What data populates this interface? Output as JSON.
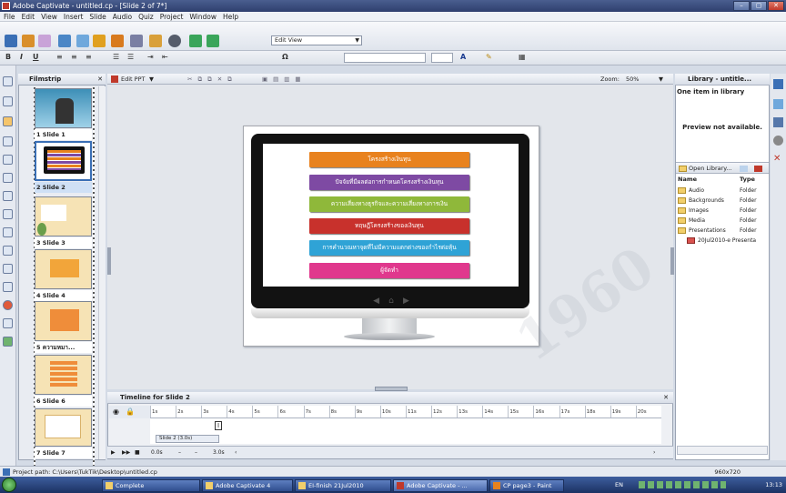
{
  "window": {
    "title": "Adobe Captivate - untitled.cp - [Slide 2 of 7*]",
    "controls": [
      "–",
      "▢",
      "✕"
    ]
  },
  "menu": [
    "File",
    "Edit",
    "View",
    "Insert",
    "Slide",
    "Audio",
    "Quiz",
    "Project",
    "Window",
    "Help"
  ],
  "toolbar": {
    "view_select": "Edit View"
  },
  "format": {
    "bold": "B",
    "italic": "I",
    "underline": "U",
    "omega": "Ω"
  },
  "filmstrip": {
    "title": "Filmstrip",
    "close": "✕",
    "slides": [
      {
        "label": "1 Slide 1"
      },
      {
        "label": "2 Slide 2"
      },
      {
        "label": "3 Slide 3"
      },
      {
        "label": "4 Slide 4"
      },
      {
        "label": "5 ความหมา..."
      },
      {
        "label": "6 Slide 6"
      },
      {
        "label": "7 Slide 7"
      }
    ]
  },
  "stage": {
    "edit_ppt": "Edit PPT",
    "zoom_label": "Zoom:",
    "zoom_value": "50%"
  },
  "slide_menu": [
    {
      "text": "โครงสร้างเงินทุน",
      "color": "#e8821e"
    },
    {
      "text": "ปัจจัยที่มีผลต่อการกำหนดโครงสร้างเงินทุน",
      "color": "#7e4aa3"
    },
    {
      "text": "ความเสี่ยงทางธุรกิจและความเสี่ยงทางการเงิน",
      "color": "#8fb83a"
    },
    {
      "text": "ทฤษฎีโครงสร้างของเงินทุน",
      "color": "#c8312c"
    },
    {
      "text": "การคำนวณหาจุดที่ไม่มีความแตกต่างของกำไรต่อหุ้น",
      "color": "#2fa3d6"
    },
    {
      "text": "ผู้จัดทำ",
      "color": "#e0388d"
    }
  ],
  "nav_icons": [
    "◀",
    "⌂",
    "▶"
  ],
  "timeline": {
    "title": "Timeline for Slide 2",
    "close": "✕",
    "ticks": [
      "1s",
      "2s",
      "3s",
      "4s",
      "5s",
      "6s",
      "7s",
      "8s",
      "9s",
      "10s",
      "11s",
      "12s",
      "13s",
      "14s",
      "15s",
      "16s",
      "17s",
      "18s",
      "19s",
      "20s"
    ],
    "track_label": "Slide 2 (3.0s)",
    "time_start": "0.0s",
    "time_end": "3.0s"
  },
  "library": {
    "title": "Library - untitle...",
    "count": "One item in library",
    "preview": "Preview not available.",
    "open": "Open Library...",
    "col_name": "Name",
    "col_type": "Type",
    "items": [
      {
        "name": "Audio",
        "type": "Folder"
      },
      {
        "name": "Backgrounds",
        "type": "Folder"
      },
      {
        "name": "Images",
        "type": "Folder"
      },
      {
        "name": "Media",
        "type": "Folder"
      },
      {
        "name": "Presentations",
        "type": "Folder"
      },
      {
        "name": "20Jul2010-e Presenta",
        "type": ""
      }
    ]
  },
  "status": {
    "path": "Project path: C:\\Users\\TukTik\\Desktop\\untitled.cp",
    "resolution": "960x720"
  },
  "taskbar": {
    "tasks": [
      "Complete",
      "Adobe Captivate 4",
      "EI-finish 21Jul2010",
      "Adobe Captivate - ...",
      "CP page3 - Paint"
    ],
    "lang": "EN",
    "clock": "13:13"
  },
  "watermark": "1960"
}
